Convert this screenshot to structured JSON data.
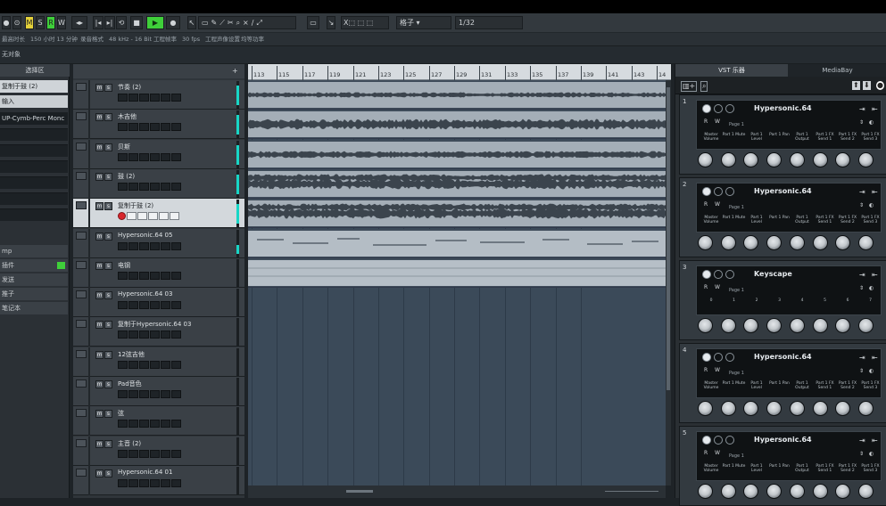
{
  "toolbar": {
    "buttons": [
      "M",
      "S",
      "R",
      "W"
    ],
    "tool_select_label": "格子",
    "quantize_value": "1/32"
  },
  "statusbar": {
    "items": [
      "最高时长",
      "150 小时 13 分钟",
      "录音格式",
      "48 kHz - 16 Bit",
      "工程帧率",
      "30 fps",
      "工程声像设置",
      "均等功率"
    ]
  },
  "infoline": {
    "text": "无对象"
  },
  "inspector": {
    "header": "选择区",
    "track_name": "复制于鼓 (2)",
    "input": "输入",
    "patch": "UP-Cymb-Perc Monc",
    "sections": [
      "mp",
      "插件",
      "发送",
      "推子",
      "笔记本"
    ]
  },
  "ruler": {
    "bars": [
      "113",
      "115",
      "117",
      "119",
      "121",
      "123",
      "125",
      "127",
      "129",
      "131",
      "133",
      "135",
      "137",
      "139",
      "141",
      "143",
      "14"
    ]
  },
  "tracks": [
    {
      "name": "节奏 (2)",
      "selected": false,
      "rec": false
    },
    {
      "name": "木吉他",
      "selected": false,
      "rec": false
    },
    {
      "name": "贝斯",
      "selected": false,
      "rec": false
    },
    {
      "name": "鼓 (2)",
      "selected": false,
      "rec": false
    },
    {
      "name": "复制于鼓 (2)",
      "selected": true,
      "rec": true
    },
    {
      "name": "Hypersonic.64 05",
      "selected": false,
      "rec": false
    },
    {
      "name": "电钢",
      "selected": false,
      "rec": false
    },
    {
      "name": "Hypersonic.64 03",
      "selected": false,
      "rec": false
    },
    {
      "name": "复制于Hypersonic.64 03",
      "selected": false,
      "rec": false
    },
    {
      "name": "12弦吉他",
      "selected": false,
      "rec": false
    },
    {
      "name": "Pad音色",
      "selected": false,
      "rec": false
    },
    {
      "name": "弦",
      "selected": false,
      "rec": false
    },
    {
      "name": "主音 (2)",
      "selected": false,
      "rec": false
    },
    {
      "name": "Hypersonic.64 01",
      "selected": false,
      "rec": false
    }
  ],
  "vst": {
    "tabs": [
      "VST 乐器",
      "MediaBay"
    ],
    "racks": [
      {
        "num": "1",
        "name": "Hypersonic.64",
        "page": "Page 1",
        "labels": [
          "Master Volume",
          "Part 1 Mute",
          "Part 1 Level",
          "Part 1 Pan",
          "Part 1 Output",
          "Part 1 FX Send 1",
          "Part 1 FX Send 2",
          "Part 1 FX Send 3"
        ]
      },
      {
        "num": "2",
        "name": "Hypersonic.64",
        "page": "Page 1",
        "labels": [
          "Master Volume",
          "Part 1 Mute",
          "Part 1 Level",
          "Part 1 Pan",
          "Part 1 Output",
          "Part 1 FX Send 1",
          "Part 1 FX Send 2",
          "Part 1 FX Send 3"
        ]
      },
      {
        "num": "3",
        "name": "Keyscape",
        "page": "Page 1",
        "labels": [
          "0",
          "1",
          "2",
          "3",
          "4",
          "5",
          "6",
          "7"
        ]
      },
      {
        "num": "4",
        "name": "Hypersonic.64",
        "page": "Page 1",
        "labels": [
          "Master Volume",
          "Part 1 Mute",
          "Part 1 Level",
          "Part 1 Pan",
          "Part 1 Output",
          "Part 1 FX Send 1",
          "Part 1 FX Send 2",
          "Part 1 FX Send 3"
        ]
      },
      {
        "num": "5",
        "name": "Hypersonic.64",
        "page": "Page 1",
        "labels": [
          "Master Volume",
          "Part 1 Mute",
          "Part 1 Level",
          "Part 1 Pan",
          "Part 1 Output",
          "Part 1 FX Send 1",
          "Part 1 FX Send 2",
          "Part 1 FX Send 3"
        ]
      }
    ]
  },
  "colors": {
    "accent_teal": "#18d6c6",
    "record_red": "#d8262c",
    "play_green": "#3fcf3a",
    "solo_yellow": "#e4d13a"
  }
}
